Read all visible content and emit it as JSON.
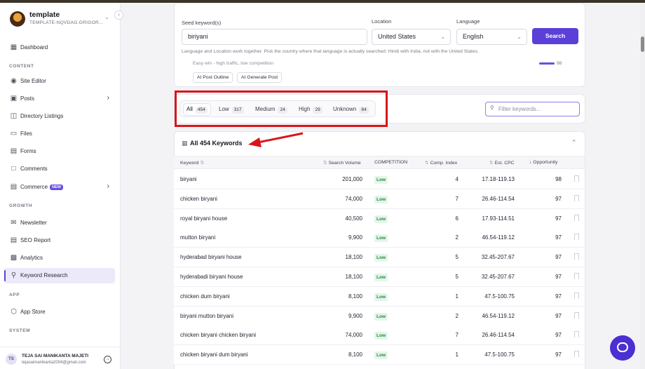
{
  "workspace": {
    "name": "template",
    "subtitle": "TEMPLATE-NQVDAG.GRIGOR..."
  },
  "sidebar": {
    "dashboard": "Dashboard",
    "content_label": "CONTENT",
    "content_items": [
      "Site Editor",
      "Posts",
      "Directory Listings",
      "Files",
      "Forms",
      "Comments",
      "Commerce"
    ],
    "commerce_badge": "NEW",
    "growth_label": "GROWTH",
    "growth_items": [
      "Newsletter",
      "SEO Report",
      "Analytics",
      "Keyword Research"
    ],
    "app_label": "APP",
    "app_items": [
      "App Store"
    ],
    "system_label": "SYSTEM"
  },
  "user": {
    "initials": "TS",
    "name": "TEJA SAI MANIKANTA MAJETI",
    "email": "tejasaimanikanta2004@gmail.com"
  },
  "search": {
    "seed_label": "Seed keyword(s)",
    "seed_value": "biriyani",
    "location_label": "Location",
    "location_value": "United States",
    "language_label": "Language",
    "language_value": "English",
    "search_button": "Search",
    "hint": "Language and Location work together. Pick the country where that language is actually searched: Hindi with India, not with the United States.",
    "partial_text": "Easy win - high traffic, low competition",
    "partial_num": "98",
    "ai_outline": "AI Post Outline",
    "ai_generate": "AI Generate Post"
  },
  "tabs": [
    {
      "label": "All",
      "count": "454"
    },
    {
      "label": "Low",
      "count": "317"
    },
    {
      "label": "Medium",
      "count": "24"
    },
    {
      "label": "High",
      "count": "29"
    },
    {
      "label": "Unknown",
      "count": "84"
    }
  ],
  "filter_placeholder": "Filter keywords...",
  "table": {
    "title": "All 454 Keywords",
    "headers": {
      "keyword": "Keyword",
      "volume": "Search Volume",
      "competition": "COMPETITION",
      "index": "Comp. Index",
      "cpc": "Est. CPC",
      "opportunity": "Opportunity"
    },
    "rows": [
      {
        "keyword": "biryani",
        "volume": "201,000",
        "competition": "Low",
        "index": "4",
        "cpc": "17.18-119.13",
        "opportunity": "98"
      },
      {
        "keyword": "chicken biryani",
        "volume": "74,000",
        "competition": "Low",
        "index": "7",
        "cpc": "26.46-114.54",
        "opportunity": "97"
      },
      {
        "keyword": "royal biryani house",
        "volume": "40,500",
        "competition": "Low",
        "index": "6",
        "cpc": "17.93-114.51",
        "opportunity": "97"
      },
      {
        "keyword": "mutton biryani",
        "volume": "9,900",
        "competition": "Low",
        "index": "2",
        "cpc": "46.54-119.12",
        "opportunity": "97"
      },
      {
        "keyword": "hyderabad biryani house",
        "volume": "18,100",
        "competition": "Low",
        "index": "5",
        "cpc": "32.45-207.67",
        "opportunity": "97"
      },
      {
        "keyword": "hyderabadi biryani house",
        "volume": "18,100",
        "competition": "Low",
        "index": "5",
        "cpc": "32.45-207.67",
        "opportunity": "97"
      },
      {
        "keyword": "chicken dum biryani",
        "volume": "8,100",
        "competition": "Low",
        "index": "1",
        "cpc": "47.5-100.75",
        "opportunity": "97"
      },
      {
        "keyword": "biryani mutton biryani",
        "volume": "9,900",
        "competition": "Low",
        "index": "2",
        "cpc": "46.54-119.12",
        "opportunity": "97"
      },
      {
        "keyword": "chicken biryani chicken biryani",
        "volume": "74,000",
        "competition": "Low",
        "index": "7",
        "cpc": "26.46-114.54",
        "opportunity": "97"
      },
      {
        "keyword": "chicken biryani dum biryani",
        "volume": "8,100",
        "competition": "Low",
        "index": "1",
        "cpc": "47.5-100.75",
        "opportunity": "97"
      }
    ]
  },
  "colors": {
    "accent": "#5b3fd8",
    "highlight": "#d9151b",
    "low_badge": "#1f8a3f"
  }
}
